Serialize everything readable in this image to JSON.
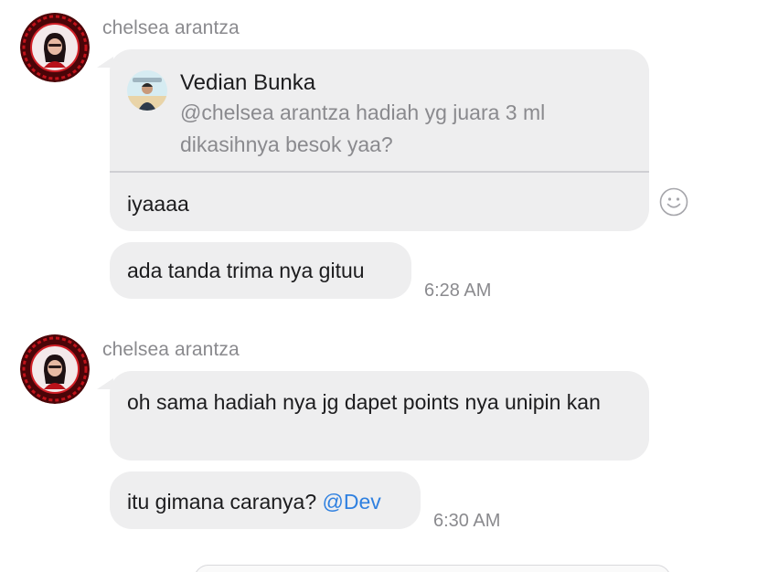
{
  "groups": [
    {
      "sender": "chelsea arantza",
      "messages": [
        {
          "reply_to": {
            "name": "Vedian Bunka",
            "text": "@chelsea arantza hadiah yg juara 3 ml dikasihnya besok yaa?"
          },
          "text": "iyaaaa"
        },
        {
          "text": "ada tanda trima nya gituu",
          "time": "6:28 AM"
        }
      ]
    },
    {
      "sender": "chelsea arantza",
      "messages": [
        {
          "text": "oh sama hadiah nya jg dapet points nya unipin kan"
        },
        {
          "text": "itu gimana caranya?",
          "mention": "@Dev",
          "time": "6:30 AM"
        }
      ]
    }
  ],
  "icons": {
    "reaction": "smiley-face-icon",
    "avatar": "profile-photo",
    "quote_avatar": "profile-photo"
  },
  "colors": {
    "bubble": "#eeeeef",
    "mention": "#2f80e0",
    "avatar_ring": "#8b0d10"
  }
}
